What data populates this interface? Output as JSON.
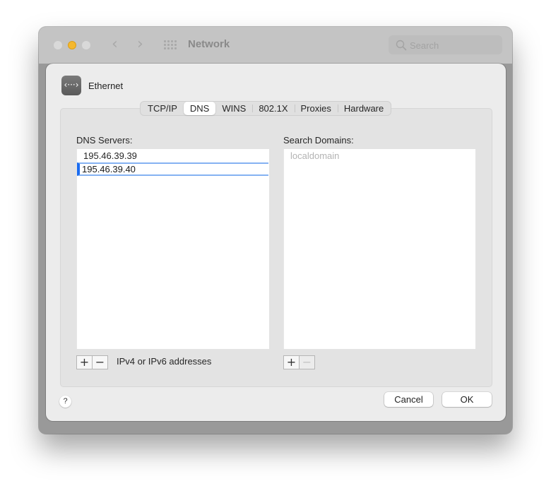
{
  "window": {
    "title": "Network",
    "traffic_lights": [
      "close",
      "minimize",
      "zoom"
    ],
    "nav": {
      "back_icon": "chevron-left-icon",
      "forward_icon": "chevron-right-icon",
      "grid_icon": "grid-icon"
    },
    "search": {
      "placeholder": "Search",
      "value": ""
    },
    "colors": {
      "minimize": "#f5b82e",
      "accent": "#1b6cf0"
    }
  },
  "sheet": {
    "interface_icon": "ethernet-icon",
    "interface_icon_glyph": "‹···›",
    "interface_name": "Ethernet",
    "tabs": [
      {
        "label": "TCP/IP",
        "active": false
      },
      {
        "label": "DNS",
        "active": true
      },
      {
        "label": "WINS",
        "active": false
      },
      {
        "label": "802.1X",
        "active": false
      },
      {
        "label": "Proxies",
        "active": false
      },
      {
        "label": "Hardware",
        "active": false
      }
    ],
    "dns": {
      "label": "DNS Servers:",
      "servers": [
        "195.46.39.39"
      ],
      "editing_value": "195.46.39.40",
      "add_label": "+",
      "remove_label": "−",
      "hint": "IPv4 or IPv6 addresses"
    },
    "search_domains": {
      "label": "Search Domains:",
      "placeholder": "localdomain",
      "add_label": "+",
      "remove_label": "−"
    },
    "help_label": "?",
    "cancel_label": "Cancel",
    "ok_label": "OK"
  }
}
